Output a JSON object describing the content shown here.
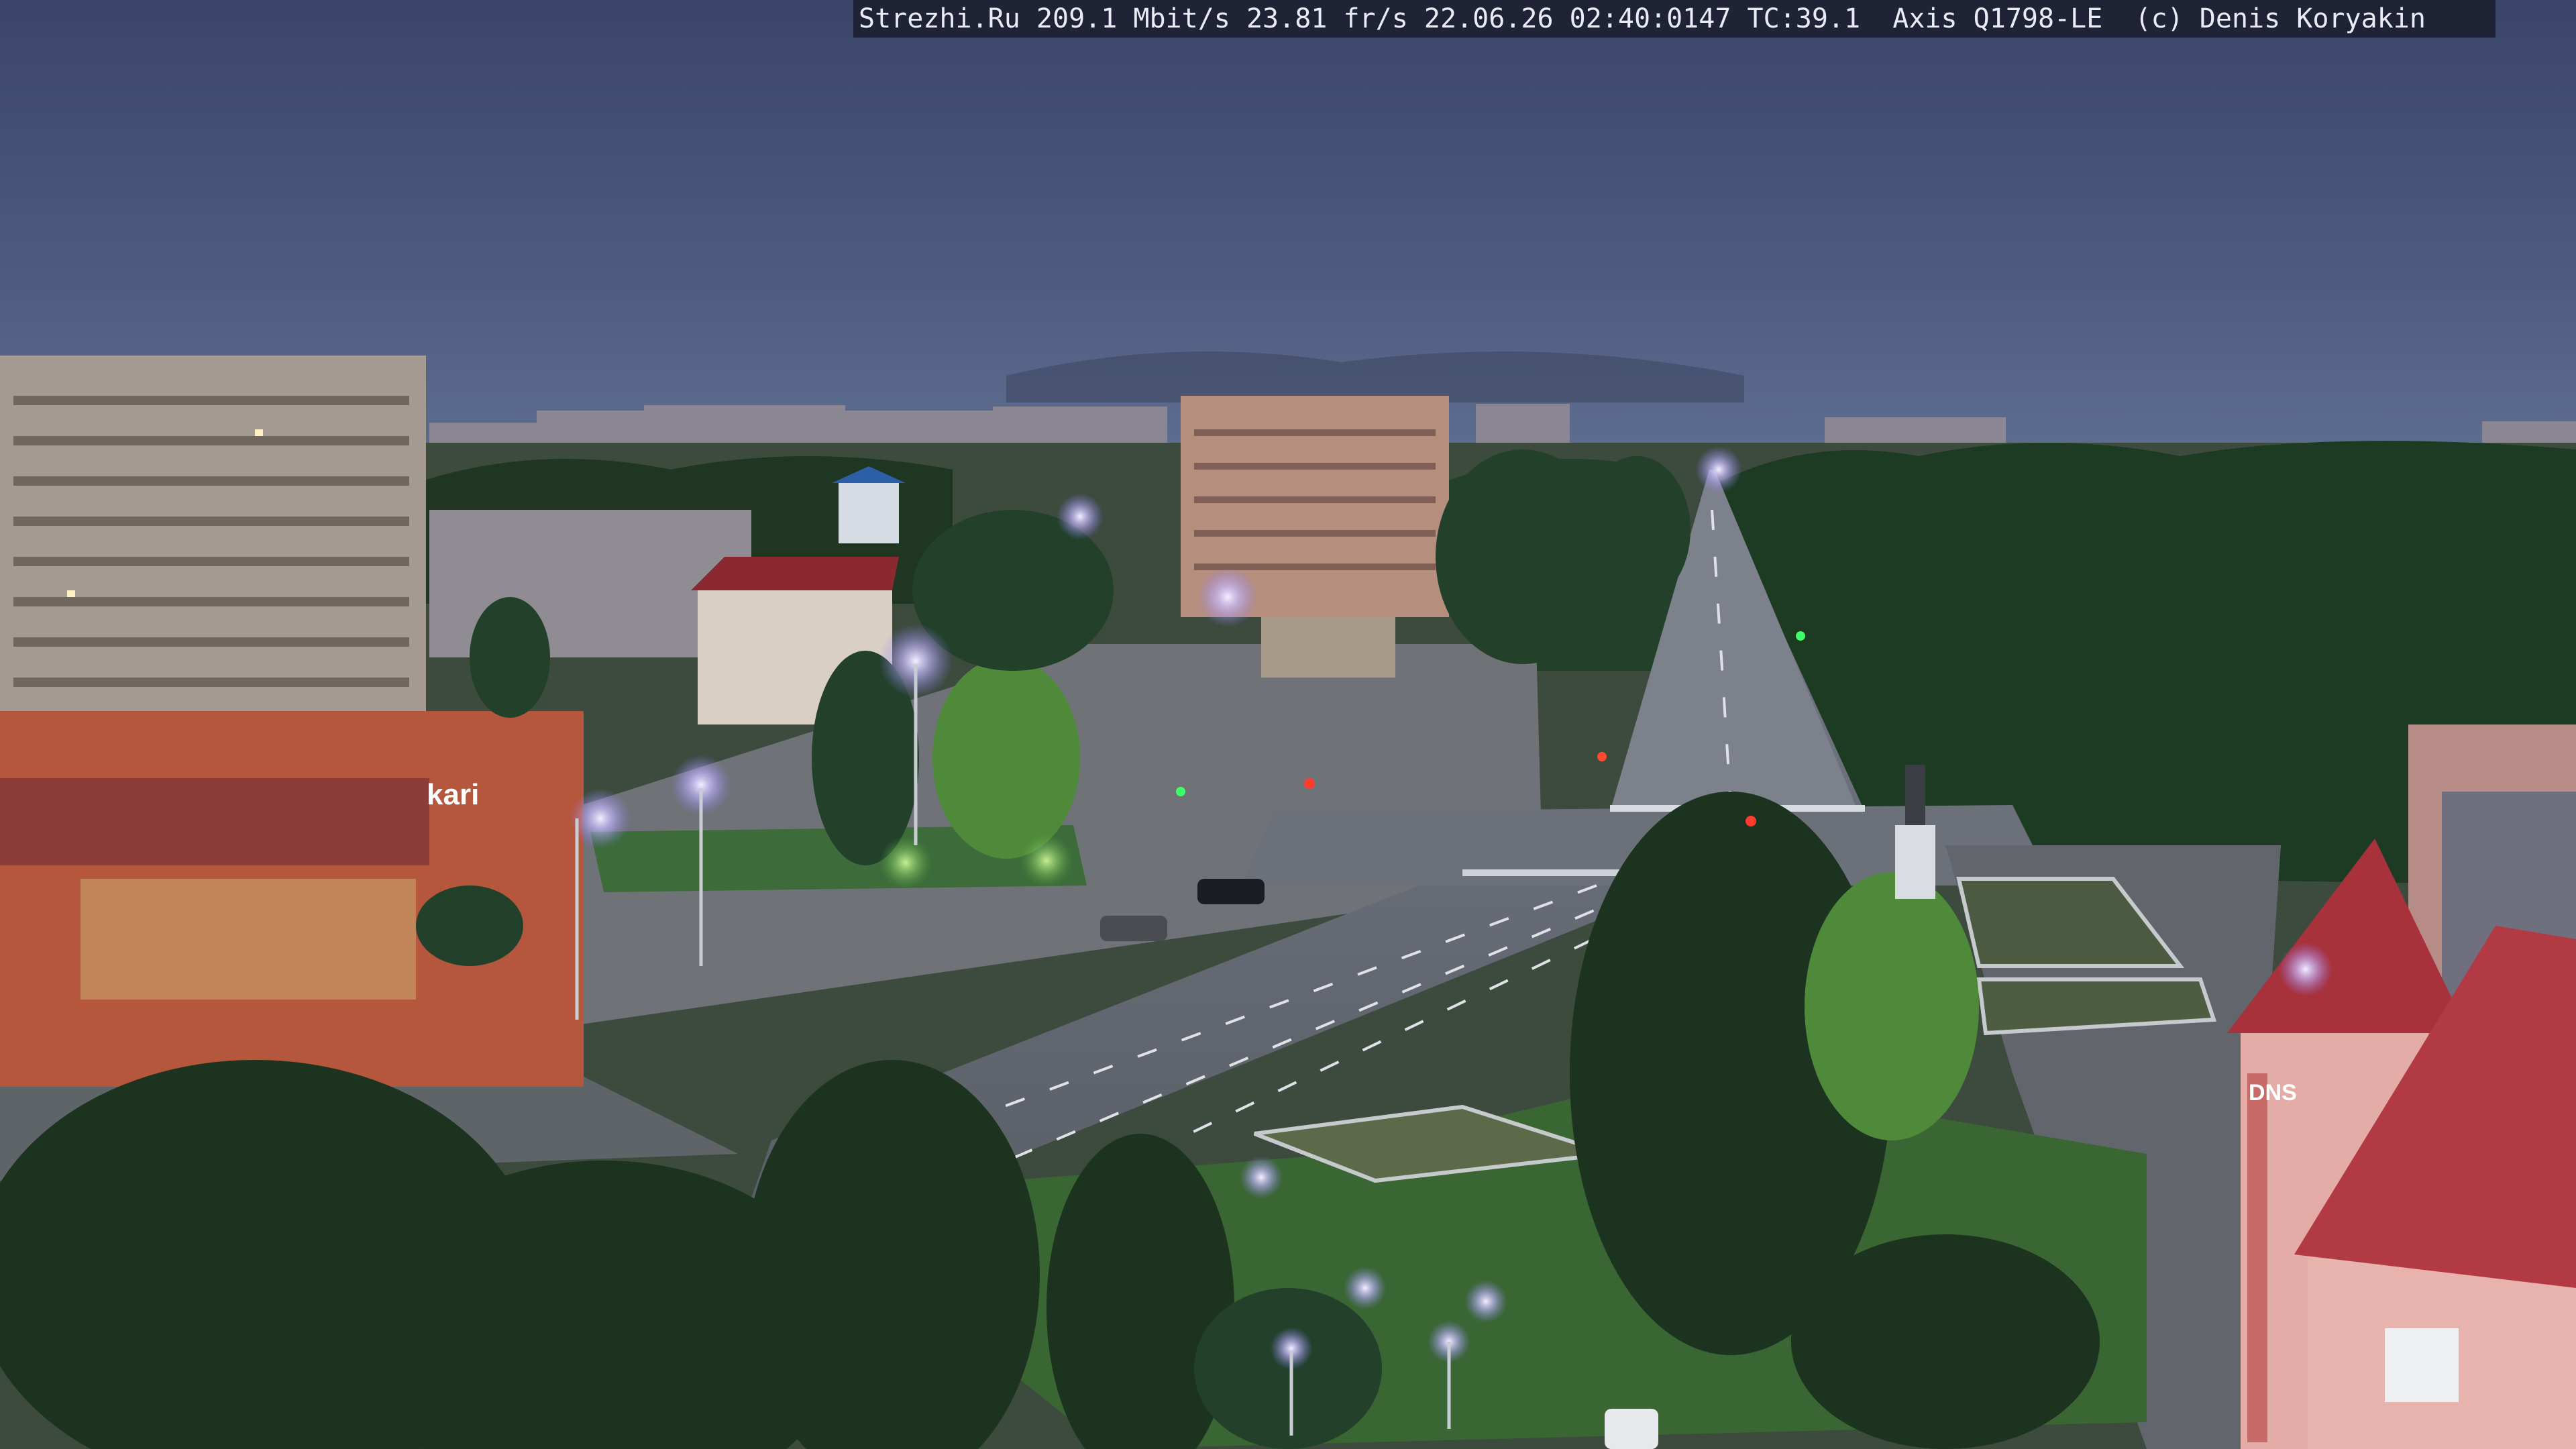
{
  "overlay": {
    "caption": "Strezhi.Ru 209.1 Mbit/s 23.81 fr/s 22.06.26 02:40:0147 TC:39.1  Axis Q1798-LE  (c) Denis Koryakin"
  },
  "signs": {
    "store": "kari",
    "building_right": "DNS"
  },
  "colors": {
    "sky_top": "#3b4469",
    "sky_horizon": "#5c6c8e",
    "trees": "#1c3320",
    "lamp_glow": "#d8ccff",
    "roof_red": "#a8323c"
  }
}
